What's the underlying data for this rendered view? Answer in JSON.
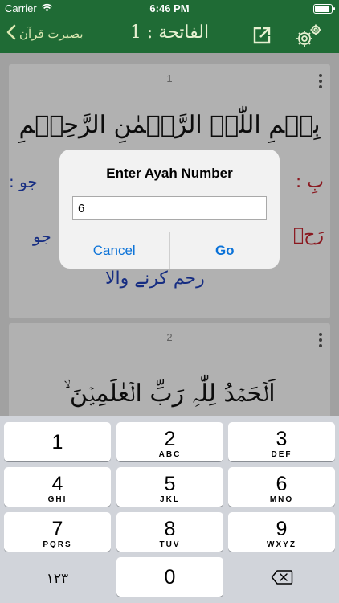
{
  "status": {
    "carrier": "Carrier",
    "time": "6:46 PM"
  },
  "nav": {
    "back_label": "بصیرت قرآن",
    "title": "الفاتحة : 1"
  },
  "cards": [
    {
      "number": "1",
      "arabic": "بِسۡمِ اللّٰہِ الرَّحۡمٰنِ الرَّحِیۡمِ",
      "urdu_left": "جو :",
      "urdu_left2": "جو",
      "urdu_right_red": "بِ :",
      "urdu_right2_red": "رَحۡ",
      "urdu_bottom": "رحم کرنے والا"
    },
    {
      "number": "2",
      "arabic": "اَلۡحَمۡدُ لِلّٰہِ رَبِّ الۡعٰلَمِیۡنَ ۙ"
    }
  ],
  "alert": {
    "title": "Enter Ayah Number",
    "value": "6",
    "cancel": "Cancel",
    "go": "Go"
  },
  "keyboard": {
    "keys": [
      {
        "num": "1",
        "letters": ""
      },
      {
        "num": "2",
        "letters": "ABC"
      },
      {
        "num": "3",
        "letters": "DEF"
      },
      {
        "num": "4",
        "letters": "GHI"
      },
      {
        "num": "5",
        "letters": "JKL"
      },
      {
        "num": "6",
        "letters": "MNO"
      },
      {
        "num": "7",
        "letters": "PQRS"
      },
      {
        "num": "8",
        "letters": "TUV"
      },
      {
        "num": "9",
        "letters": "WXYZ"
      },
      {
        "num": "0",
        "letters": ""
      }
    ],
    "switch_label": "١٢٣"
  },
  "colors": {
    "nav_green": "#1f6b35",
    "urdu_blue": "#1f3fb5",
    "urdu_red": "#c0202a",
    "link_blue": "#0a72d8"
  },
  "icons": [
    "wifi-icon",
    "battery-icon",
    "chevron-left-icon",
    "share-icon",
    "gear-icon",
    "kebab-icon",
    "delete-icon"
  ]
}
